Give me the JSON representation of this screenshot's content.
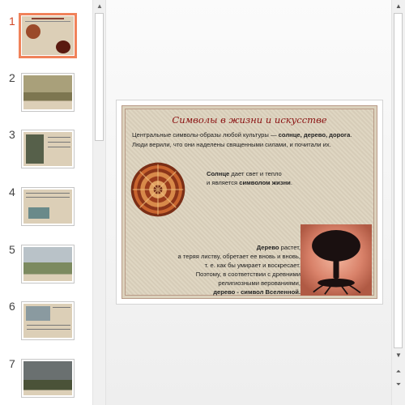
{
  "thumbnails": [
    {
      "num": "1"
    },
    {
      "num": "2"
    },
    {
      "num": "3"
    },
    {
      "num": "4"
    },
    {
      "num": "5"
    },
    {
      "num": "6"
    },
    {
      "num": "7"
    }
  ],
  "slide": {
    "title": "Символы в жизни и искусстве",
    "intro_plain": "Центральные символы-образы любой культуры — ",
    "intro_bold": "солнце, дерево, дорога",
    "intro_rest": ". Люди верили, что они наделены священными силами, и почитали их.",
    "sun_bold": "Солнце",
    "sun_rest": " дает свет и тепло",
    "sun_line2_plain": "и является ",
    "sun_line2_bold": "символом жизни",
    "sun_line2_end": ".",
    "tree_bold": "Дерево",
    "tree_rest": " растет,",
    "tree_line2": "а теряя листву, обретает ее вновь и вновь,",
    "tree_line3": "т. е. как бы умирает и воскресает.",
    "tree_line4": "Поэтому, в соответствии с древними",
    "tree_line5": "религиозными верованиями,",
    "tree_line6": "дерево - символ Вселенной."
  },
  "colors": {
    "active_accent": "#f0825a",
    "title_color": "#8a1010",
    "slide_bg": "#ddd3be"
  }
}
